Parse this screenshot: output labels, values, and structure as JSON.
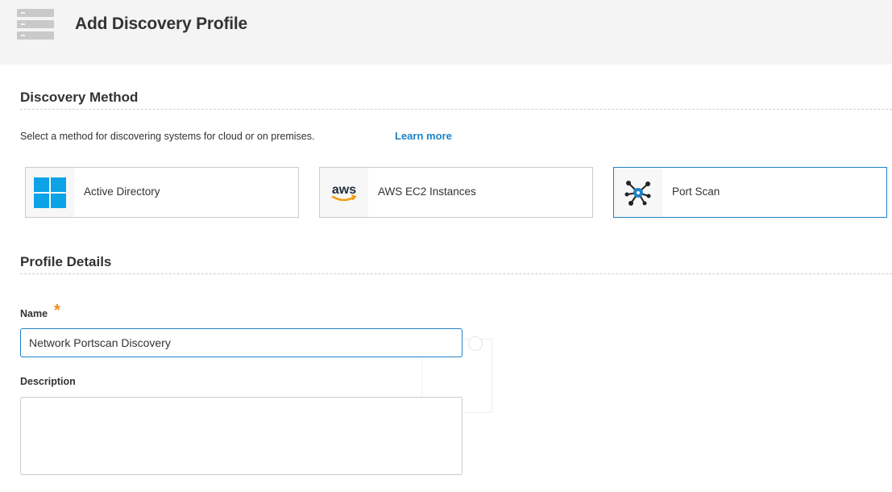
{
  "header": {
    "title": "Add Discovery Profile",
    "icon": "server-stack-icon"
  },
  "discovery_method": {
    "title": "Discovery Method",
    "subtitle": "Select a method for discovering systems for cloud or on premises.",
    "learn_more": "Learn more",
    "methods": [
      {
        "label": "Active Directory",
        "icon": "windows-logo-icon",
        "selected": false
      },
      {
        "label": "AWS EC2 Instances",
        "icon": "aws-logo-icon",
        "selected": false
      },
      {
        "label": "Port Scan",
        "icon": "network-scan-icon",
        "selected": true
      }
    ]
  },
  "profile_details": {
    "title": "Profile Details",
    "name_label": "Name",
    "required_marker": "*",
    "name_value": "Network Portscan Discovery",
    "description_label": "Description",
    "description_value": ""
  },
  "colors": {
    "accent": "#1f82c8",
    "required": "#f08a1d",
    "header_bg": "#f4f4f4",
    "windows_blue": "#0ea2e6",
    "aws_orange": "#f39c12"
  }
}
